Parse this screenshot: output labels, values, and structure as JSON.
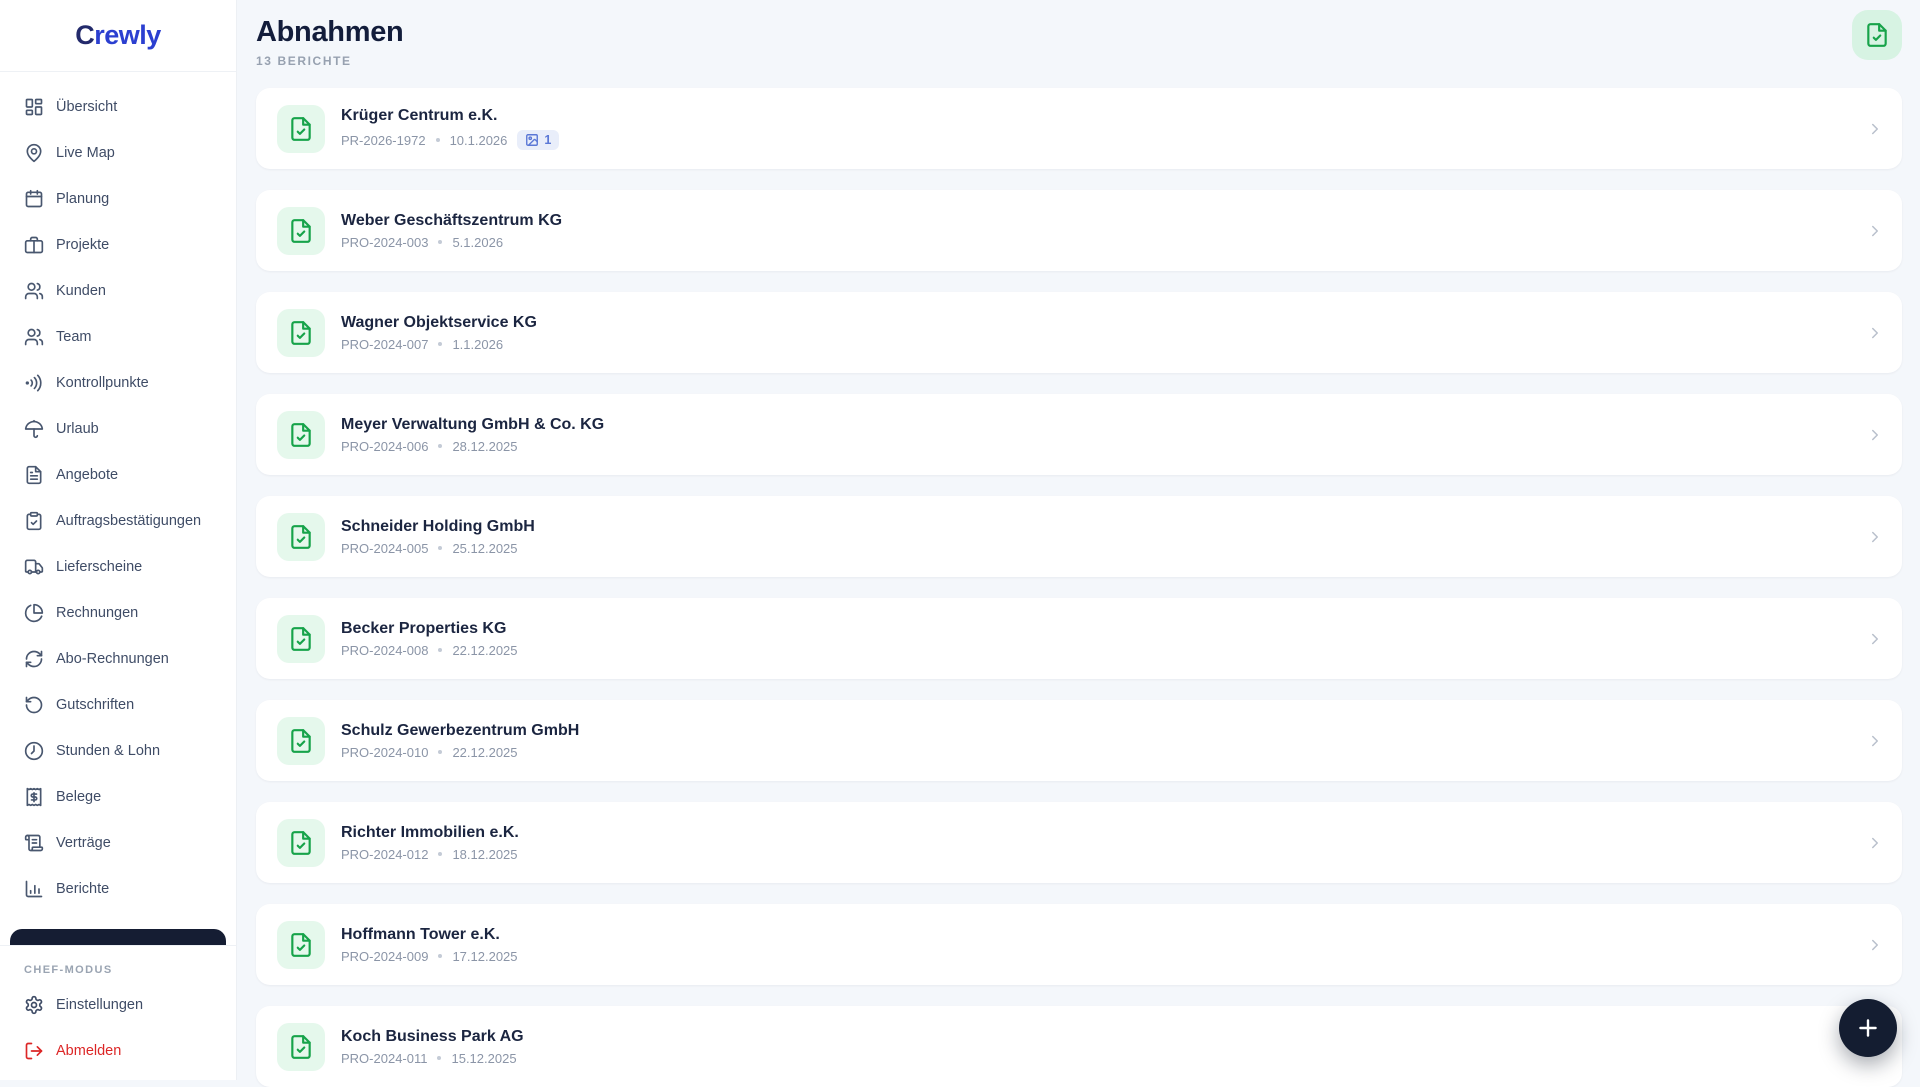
{
  "brand": {
    "mark": "C",
    "rest": "rewly"
  },
  "sidebar": {
    "items": [
      {
        "label": "Übersicht"
      },
      {
        "label": "Live Map"
      },
      {
        "label": "Planung"
      },
      {
        "label": "Projekte"
      },
      {
        "label": "Kunden"
      },
      {
        "label": "Team"
      },
      {
        "label": "Kontrollpunkte"
      },
      {
        "label": "Urlaub"
      },
      {
        "label": "Angebote"
      },
      {
        "label": "Auftragsbestätigungen"
      },
      {
        "label": "Lieferscheine"
      },
      {
        "label": "Rechnungen"
      },
      {
        "label": "Abo-Rechnungen"
      },
      {
        "label": "Gutschriften"
      },
      {
        "label": "Stunden & Lohn"
      },
      {
        "label": "Belege"
      },
      {
        "label": "Verträge"
      },
      {
        "label": "Berichte"
      }
    ],
    "section_label": "CHEF-MODUS",
    "settings_label": "Einstellungen",
    "logout_label": "Abmelden"
  },
  "header": {
    "title": "Abnahmen",
    "subtitle": "13 BERICHTE"
  },
  "list": {
    "rows": [
      {
        "title": "Krüger Centrum e.K.",
        "ref": "PR-2026-1972",
        "date": "10.1.2026",
        "badge": "1"
      },
      {
        "title": "Weber Geschäftszentrum KG",
        "ref": "PRO-2024-003",
        "date": "5.1.2026"
      },
      {
        "title": "Wagner Objektservice KG",
        "ref": "PRO-2024-007",
        "date": "1.1.2026"
      },
      {
        "title": "Meyer Verwaltung GmbH & Co. KG",
        "ref": "PRO-2024-006",
        "date": "28.12.2025"
      },
      {
        "title": "Schneider Holding GmbH",
        "ref": "PRO-2024-005",
        "date": "25.12.2025"
      },
      {
        "title": "Becker Properties KG",
        "ref": "PRO-2024-008",
        "date": "22.12.2025"
      },
      {
        "title": "Schulz Gewerbezentrum GmbH",
        "ref": "PRO-2024-010",
        "date": "22.12.2025"
      },
      {
        "title": "Richter Immobilien e.K.",
        "ref": "PRO-2024-012",
        "date": "18.12.2025"
      },
      {
        "title": "Hoffmann Tower e.K.",
        "ref": "PRO-2024-009",
        "date": "17.12.2025"
      },
      {
        "title": "Koch Business Park AG",
        "ref": "PRO-2024-011",
        "date": "15.12.2025"
      }
    ]
  },
  "colors": {
    "accent_green": "#17a34a",
    "accent_green_bg": "#e5f8ec",
    "badge_blue": "#5b78d6",
    "badge_bg": "#e9eefa",
    "danger_red": "#dc2626",
    "fab_navy": "#141d31",
    "brand_navy": "#232a6b",
    "brand_blue": "#2b3fd0",
    "page_bg": "#f4f7fb"
  }
}
